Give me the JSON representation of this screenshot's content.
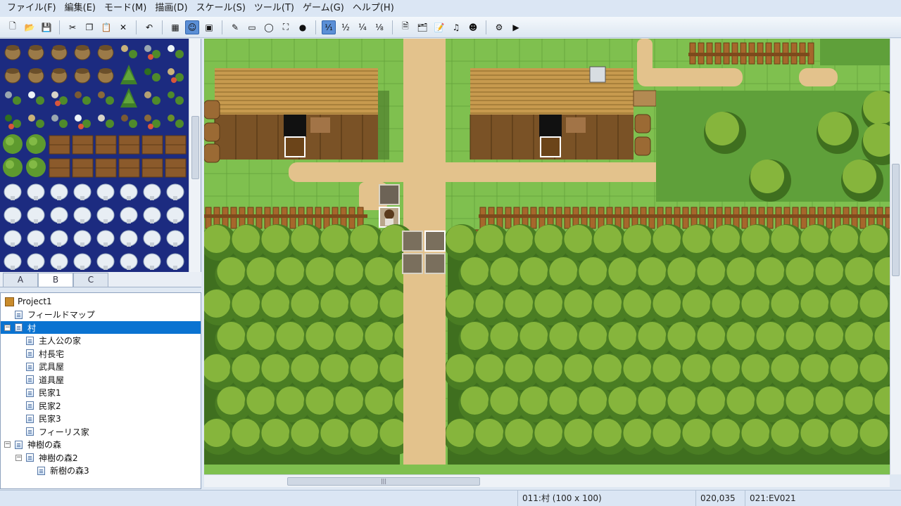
{
  "menubar": {
    "items": [
      "ファイル(F)",
      "編集(E)",
      "モード(M)",
      "描画(D)",
      "スケール(S)",
      "ツール(T)",
      "ゲーム(G)",
      "ヘルプ(H)"
    ]
  },
  "toolbar": {
    "buttons": [
      {
        "name": "new-project-icon",
        "glyph": "🗋"
      },
      {
        "name": "open-project-icon",
        "glyph": "📂"
      },
      {
        "name": "save-project-icon",
        "glyph": "💾"
      },
      {
        "name": "cut-icon",
        "glyph": "✂"
      },
      {
        "name": "copy-icon",
        "glyph": "❐"
      },
      {
        "name": "paste-icon",
        "glyph": "📋"
      },
      {
        "name": "delete-icon",
        "glyph": "✕"
      },
      {
        "name": "undo-icon",
        "glyph": "↶"
      },
      {
        "name": "map-mode-icon",
        "glyph": "▦"
      },
      {
        "name": "event-mode-icon",
        "glyph": "☺"
      },
      {
        "name": "region-mode-icon",
        "glyph": "▣"
      },
      {
        "name": "pencil-icon",
        "glyph": "✎"
      },
      {
        "name": "rectangle-icon",
        "glyph": "▭"
      },
      {
        "name": "ellipse-icon",
        "glyph": "◯"
      },
      {
        "name": "fill-icon",
        "glyph": "⛶"
      },
      {
        "name": "shadow-pen-icon",
        "glyph": "●"
      },
      {
        "name": "scale-1-1-icon",
        "glyph": "¹⁄₁"
      },
      {
        "name": "scale-1-2-icon",
        "glyph": "½"
      },
      {
        "name": "scale-1-4-icon",
        "glyph": "¼"
      },
      {
        "name": "scale-1-8-icon",
        "glyph": "⅛"
      },
      {
        "name": "database-icon",
        "glyph": "🗎"
      },
      {
        "name": "resource-manager-icon",
        "glyph": "🗂"
      },
      {
        "name": "script-editor-icon",
        "glyph": "📝"
      },
      {
        "name": "sound-test-icon",
        "glyph": "♫"
      },
      {
        "name": "character-generator-icon",
        "glyph": "☻"
      },
      {
        "name": "options-icon",
        "glyph": "⚙"
      },
      {
        "name": "playtest-icon",
        "glyph": "▶"
      }
    ],
    "active": [
      "event-mode-icon",
      "scale-1-1-icon"
    ]
  },
  "tileset": {
    "tabs": [
      "A",
      "B",
      "C"
    ],
    "selected_tab": "B"
  },
  "tree": {
    "items": [
      {
        "label": "Project1",
        "depth": 0,
        "kind": "project",
        "expander": ""
      },
      {
        "label": "フィールドマップ",
        "depth": 1,
        "kind": "map",
        "expander": ""
      },
      {
        "label": "村",
        "depth": 1,
        "kind": "map",
        "expander": "−",
        "selected": true
      },
      {
        "label": "主人公の家",
        "depth": 2,
        "kind": "map",
        "expander": ""
      },
      {
        "label": "村長宅",
        "depth": 2,
        "kind": "map",
        "expander": ""
      },
      {
        "label": "武具屋",
        "depth": 2,
        "kind": "map",
        "expander": ""
      },
      {
        "label": "道具屋",
        "depth": 2,
        "kind": "map",
        "expander": ""
      },
      {
        "label": "民家1",
        "depth": 2,
        "kind": "map",
        "expander": ""
      },
      {
        "label": "民家2",
        "depth": 2,
        "kind": "map",
        "expander": ""
      },
      {
        "label": "民家3",
        "depth": 2,
        "kind": "map",
        "expander": ""
      },
      {
        "label": "フィーリス家",
        "depth": 2,
        "kind": "map",
        "expander": ""
      },
      {
        "label": "神樹の森",
        "depth": 1,
        "kind": "map",
        "expander": "−"
      },
      {
        "label": "神樹の森2",
        "depth": 2,
        "kind": "map",
        "expander": "−"
      },
      {
        "label": "新樹の森3",
        "depth": 3,
        "kind": "map",
        "expander": ""
      }
    ]
  },
  "statusbar": {
    "map_info": "011:村 (100 x 100)",
    "coords": "020,035",
    "event": "021:EV021"
  },
  "colors": {
    "grass": "#7fc04f",
    "dirt": "#e3c28c",
    "roof": "#c79a4e",
    "wall": "#7a5226",
    "fence": "#a6672c",
    "tree_light": "#86b53c",
    "tree_dark": "#3f6f1f",
    "selection": "#0a73d1"
  }
}
